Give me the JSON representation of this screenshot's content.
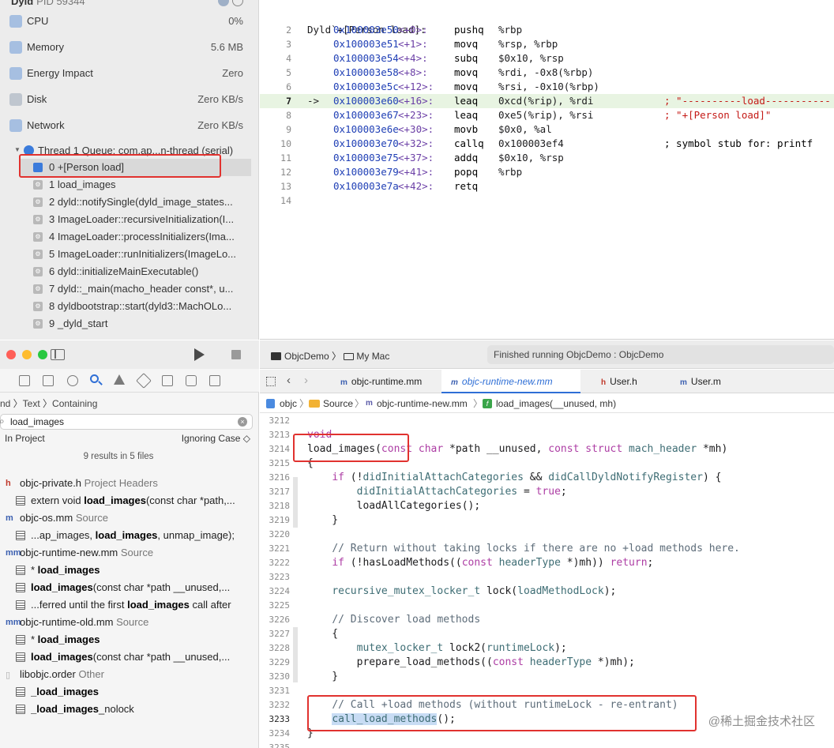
{
  "debug_navigator": {
    "process_name": "Dyld",
    "process_pid": "PID 59344",
    "gauges": [
      {
        "label": "CPU",
        "value": "0%",
        "icon": "cpu-icon",
        "color": "#6e9bd8"
      },
      {
        "label": "Memory",
        "value": "5.6 MB",
        "icon": "memory-icon",
        "color": "#6e9bd8"
      },
      {
        "label": "Energy Impact",
        "value": "Zero",
        "icon": "energy-icon",
        "color": "#6e9bd8"
      },
      {
        "label": "Disk",
        "value": "Zero KB/s",
        "icon": "disk-icon",
        "color": "#9aa7b8"
      },
      {
        "label": "Network",
        "value": "Zero KB/s",
        "icon": "network-icon",
        "color": "#6e9bd8"
      }
    ],
    "thread_label": "Thread 1 Queue: com.ap...n-thread (serial)",
    "frames": [
      "0 +[Person load]",
      "1 load_images",
      "2 dyld::notifySingle(dyld_image_states...",
      "3 ImageLoader::recursiveInitialization(I...",
      "4 ImageLoader::processInitializers(Ima...",
      "5 ImageLoader::runInitializers(ImageLo...",
      "6 dyld::initializeMainExecutable()",
      "7 dyld::_main(macho_header const*, u...",
      "8 dyldbootstrap::start(dyld3::MachOLo...",
      "9 _dyld_start"
    ],
    "selected_frame": 0
  },
  "disassembly": {
    "header": "Dyld`+[Person load]:",
    "current_line": 7,
    "arrow": "->",
    "lines": [
      {
        "n": "2",
        "addr": "0x100003e50",
        "off": "<+0>:",
        "op": "pushq",
        "args": "%rbp",
        "comment": ""
      },
      {
        "n": "3",
        "addr": "0x100003e51",
        "off": "<+1>:",
        "op": "movq",
        "args": "%rsp, %rbp",
        "comment": ""
      },
      {
        "n": "4",
        "addr": "0x100003e54",
        "off": "<+4>:",
        "op": "subq",
        "args": "$0x10, %rsp",
        "comment": ""
      },
      {
        "n": "5",
        "addr": "0x100003e58",
        "off": "<+8>:",
        "op": "movq",
        "args": "%rdi, -0x8(%rbp)",
        "comment": ""
      },
      {
        "n": "6",
        "addr": "0x100003e5c",
        "off": "<+12>:",
        "op": "movq",
        "args": "%rsi, -0x10(%rbp)",
        "comment": ""
      },
      {
        "n": "7",
        "addr": "0x100003e60",
        "off": "<+16>:",
        "op": "leaq",
        "args": "0xcd(%rip), %rdi",
        "comment": "; \"----------load-----------"
      },
      {
        "n": "8",
        "addr": "0x100003e67",
        "off": "<+23>:",
        "op": "leaq",
        "args": "0xe5(%rip), %rsi",
        "comment": "; \"+[Person load]\""
      },
      {
        "n": "9",
        "addr": "0x100003e6e",
        "off": "<+30>:",
        "op": "movb",
        "args": "$0x0, %al",
        "comment": ""
      },
      {
        "n": "10",
        "addr": "0x100003e70",
        "off": "<+32>:",
        "op": "callq",
        "args": "0x100003ef4",
        "comment": "; symbol stub for: printf"
      },
      {
        "n": "11",
        "addr": "0x100003e75",
        "off": "<+37>:",
        "op": "addq",
        "args": "$0x10, %rsp",
        "comment": ""
      },
      {
        "n": "12",
        "addr": "0x100003e79",
        "off": "<+41>:",
        "op": "popq",
        "args": "%rbp",
        "comment": ""
      },
      {
        "n": "13",
        "addr": "0x100003e7a",
        "off": "<+42>:",
        "op": "retq",
        "args": "",
        "comment": ""
      },
      {
        "n": "14",
        "addr": "",
        "off": "",
        "op": "",
        "args": "",
        "comment": ""
      }
    ]
  },
  "find_navigator": {
    "crumb": "nd 〉Text 〉Containing",
    "search_value": "load_images",
    "scope": "In Project",
    "case": "Ignoring Case ◇",
    "summary": "9 results in 5 files",
    "results": [
      {
        "kind": "file",
        "badge": "h",
        "name": "objc-private.h",
        "sub": "Project Headers"
      },
      {
        "kind": "hit",
        "pre": "extern void ",
        "hit": "load_images",
        "post": "(const char *path,..."
      },
      {
        "kind": "file",
        "badge": "m",
        "name": "objc-os.mm",
        "sub": "Source"
      },
      {
        "kind": "hit",
        "pre": "...ap_images, ",
        "hit": "load_images",
        "post": ", unmap_image);"
      },
      {
        "kind": "file",
        "badge": "mm",
        "name": "objc-runtime-new.mm",
        "sub": "Source"
      },
      {
        "kind": "hit",
        "pre": "* ",
        "hit": "load_images",
        "post": ""
      },
      {
        "kind": "hit",
        "pre": "",
        "hit": "load_images",
        "post": "(const char *path __unused,..."
      },
      {
        "kind": "hit",
        "pre": "...ferred until the first ",
        "hit": "load_images",
        "post": " call after"
      },
      {
        "kind": "file",
        "badge": "mm",
        "name": "objc-runtime-old.mm",
        "sub": "Source"
      },
      {
        "kind": "hit",
        "pre": "* ",
        "hit": "load_images",
        "post": ""
      },
      {
        "kind": "hit",
        "pre": "",
        "hit": "load_images",
        "post": "(const char *path __unused,..."
      },
      {
        "kind": "file",
        "badge": "",
        "name": "libobjc.order",
        "sub": "Other"
      },
      {
        "kind": "hit",
        "pre": "",
        "hit": "_load_images",
        "post": ""
      },
      {
        "kind": "hit",
        "pre": "",
        "hit": "_load_images",
        "post": "_nolock"
      }
    ]
  },
  "editor": {
    "scheme": "ObjcDemo",
    "destination": "My Mac",
    "status": "Finished running ObjcDemo : ObjcDemo",
    "tabs": [
      {
        "badge": "m",
        "name": "objc-runtime.mm"
      },
      {
        "badge": "m",
        "name": "objc-runtime-new.mm"
      },
      {
        "badge": "h",
        "name": "User.h"
      },
      {
        "badge": "m",
        "name": "User.m"
      }
    ],
    "active_tab": 1,
    "jump_bar": [
      "objc",
      "Source",
      "objc-runtime-new.mm",
      "load_images(__unused, mh)"
    ],
    "current_line": "3233",
    "lines": [
      {
        "n": "3212",
        "code": ""
      },
      {
        "n": "3213",
        "code": "void"
      },
      {
        "n": "3214",
        "code": "load_images(const char *path __unused, const struct mach_header *mh)"
      },
      {
        "n": "3215",
        "code": "{"
      },
      {
        "n": "3216",
        "code": "    if (!didInitialAttachCategories && didCallDyldNotifyRegister) {"
      },
      {
        "n": "3217",
        "code": "        didInitialAttachCategories = true;"
      },
      {
        "n": "3218",
        "code": "        loadAllCategories();"
      },
      {
        "n": "3219",
        "code": "    }"
      },
      {
        "n": "3220",
        "code": ""
      },
      {
        "n": "3221",
        "code": "    // Return without taking locks if there are no +load methods here."
      },
      {
        "n": "3222",
        "code": "    if (!hasLoadMethods((const headerType *)mh)) return;"
      },
      {
        "n": "3223",
        "code": ""
      },
      {
        "n": "3224",
        "code": "    recursive_mutex_locker_t lock(loadMethodLock);"
      },
      {
        "n": "3225",
        "code": ""
      },
      {
        "n": "3226",
        "code": "    // Discover load methods"
      },
      {
        "n": "3227",
        "code": "    {"
      },
      {
        "n": "3228",
        "code": "        mutex_locker_t lock2(runtimeLock);"
      },
      {
        "n": "3229",
        "code": "        prepare_load_methods((const headerType *)mh);"
      },
      {
        "n": "3230",
        "code": "    }"
      },
      {
        "n": "3231",
        "code": ""
      },
      {
        "n": "3232",
        "code": "    // Call +load methods (without runtimeLock - re-entrant)"
      },
      {
        "n": "3233",
        "code": "    call_load_methods();"
      },
      {
        "n": "3234",
        "code": "}"
      },
      {
        "n": "3235",
        "code": ""
      }
    ]
  },
  "watermark": "@稀土掘金技术社区",
  "colors": {
    "annotation_red": "#e1322f",
    "accent_blue": "#2f6fd6",
    "current_line_green": "#e8f4e2"
  }
}
